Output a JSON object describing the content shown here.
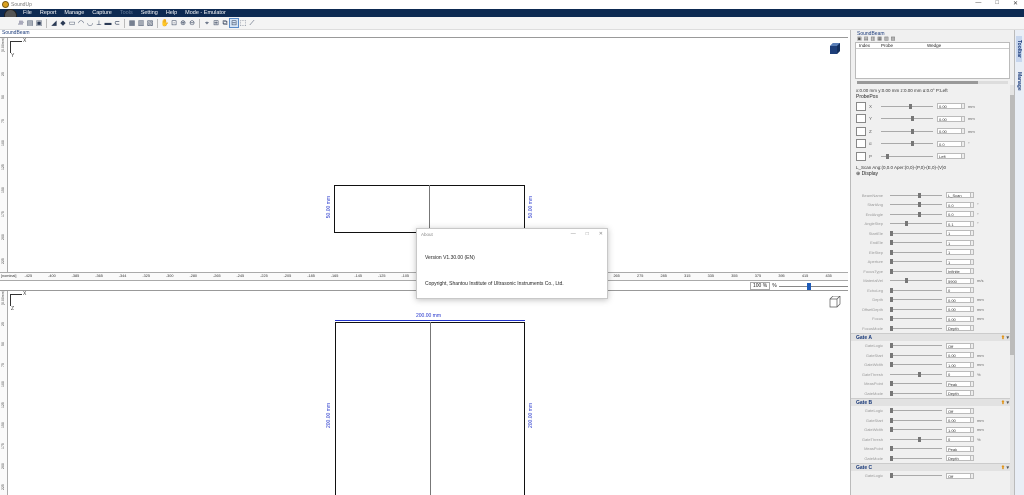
{
  "window": {
    "title": "SoundUp"
  },
  "menu": [
    {
      "label": "File",
      "disabled": false
    },
    {
      "label": "Report",
      "disabled": false
    },
    {
      "label": "Manage",
      "disabled": false
    },
    {
      "label": "Capture",
      "disabled": false
    },
    {
      "label": "Tools",
      "disabled": true
    },
    {
      "label": "Setting",
      "disabled": false
    },
    {
      "label": "Help",
      "disabled": false
    },
    {
      "label": "Mode - Emulator",
      "disabled": false
    }
  ],
  "view": {
    "tab": "SoundBeam",
    "axis_x": "X",
    "axis_y": "Y",
    "axis_z": "Z",
    "top_dim_left": "50.00 mm",
    "top_dim_right": "50.00 mm",
    "bottom_dim_width": "200.00 mm",
    "bottom_dim_left": "200.00 mm",
    "bottom_dim_right": "200.00 mm",
    "zoom": "100 %",
    "zoom_unit": "%",
    "hruler_labels": [
      "[nominal]",
      "-425",
      "-400",
      "-385",
      "-365",
      "-344",
      "-325",
      "-300",
      "-280",
      "-265",
      "-245",
      "-225",
      "-205",
      "-185",
      "-165",
      "-145",
      "-125",
      "-105",
      "-85",
      "-65",
      "-45",
      "-25",
      "210",
      "215",
      "225",
      "245",
      "265",
      "275",
      "285",
      "315",
      "335",
      "355",
      "375",
      "395",
      "415",
      "435"
    ],
    "vruler_top": [
      "[0.00mm]",
      "25",
      "50",
      "75",
      "100",
      "125",
      "150",
      "175",
      "200",
      "225"
    ],
    "vruler_bottom": [
      "[0.00mm]",
      "25",
      "50",
      "75",
      "100",
      "125",
      "150",
      "175",
      "200",
      "225"
    ]
  },
  "about": {
    "title": "About",
    "version": "Version V1.30.00 (EN)",
    "copyright": "Copyright, Shantou Institute of Ultrasonic Instruments Co., Ltd."
  },
  "panel": {
    "title": "SoundBeam",
    "columns": [
      "Index",
      "Probe",
      "Wedge"
    ],
    "info": "x:0.00 mm  y:0.00 mm  z:0.00 mm  α:0.0°  P:Left",
    "probepos_title": "ProbePos",
    "probepos": [
      {
        "label": "X",
        "value": "0.00",
        "unit": "mm"
      },
      {
        "label": "Y",
        "value": "0.00",
        "unit": "mm"
      },
      {
        "label": "Z",
        "value": "0.00",
        "unit": "mm"
      },
      {
        "label": "α",
        "value": "0.0",
        "unit": "°"
      },
      {
        "label": "P",
        "value": "Left",
        "unit": ""
      }
    ],
    "scan_info": "L_Scan  Ang:(0,0.0 Aper:(0,0)-(P,0)-(E,0)-(V)0",
    "display_label": "Display",
    "scan_rows": [
      {
        "label": "BeamName",
        "value": "L_Scan",
        "unit": ""
      },
      {
        "label": "StartAng",
        "value": "0.0",
        "unit": "°"
      },
      {
        "label": "EndAngle",
        "value": "0.0",
        "unit": "°"
      },
      {
        "label": "AngleStep",
        "value": "0.1",
        "unit": "°"
      },
      {
        "label": "StartEle",
        "value": "1",
        "unit": ""
      },
      {
        "label": "EndEle",
        "value": "1",
        "unit": ""
      },
      {
        "label": "EleStep",
        "value": "1",
        "unit": ""
      },
      {
        "label": "Aperture",
        "value": "1",
        "unit": ""
      },
      {
        "label": "FocusType",
        "value": "Infinite",
        "unit": ""
      },
      {
        "label": "MaterialVel",
        "value": "5900",
        "unit": "m/s"
      },
      {
        "label": "EchoLeg",
        "value": "0",
        "unit": ""
      },
      {
        "label": "Depth",
        "value": "0.00",
        "unit": "mm"
      },
      {
        "label": "OffsetDepth",
        "value": "0.00",
        "unit": "mm"
      },
      {
        "label": "Focus",
        "value": "0.00",
        "unit": "mm"
      },
      {
        "label": "FocusMode",
        "value": "Depth",
        "unit": ""
      }
    ],
    "gates": [
      {
        "title": "Gate A",
        "rows": [
          {
            "label": "GateLogic",
            "value": "Off",
            "unit": ""
          },
          {
            "label": "GateStart",
            "value": "0.00",
            "unit": "mm"
          },
          {
            "label": "GateWidth",
            "value": "1.00",
            "unit": "mm"
          },
          {
            "label": "GateThresh",
            "value": "0",
            "unit": "%"
          },
          {
            "label": "MeasPoint",
            "value": "Peak",
            "unit": ""
          },
          {
            "label": "GateMode",
            "value": "Depth",
            "unit": ""
          }
        ]
      },
      {
        "title": "Gate B",
        "rows": [
          {
            "label": "GateLogic",
            "value": "Off",
            "unit": ""
          },
          {
            "label": "GateStart",
            "value": "0.00",
            "unit": "mm"
          },
          {
            "label": "GateWidth",
            "value": "1.00",
            "unit": "mm"
          },
          {
            "label": "GateThresh",
            "value": "0",
            "unit": "%"
          },
          {
            "label": "MeasPoint",
            "value": "Peak",
            "unit": ""
          },
          {
            "label": "GateMode",
            "value": "Depth",
            "unit": ""
          }
        ]
      },
      {
        "title": "Gate C",
        "rows": [
          {
            "label": "GateLogic",
            "value": "Off",
            "unit": ""
          }
        ]
      }
    ]
  },
  "side_tabs": [
    "Toolbar",
    "Manage"
  ],
  "colors": {
    "menubar": "#0d2a52",
    "dim": "#2233cc",
    "accent": "#1e5bb8",
    "gate_icon": "#e08a00"
  }
}
